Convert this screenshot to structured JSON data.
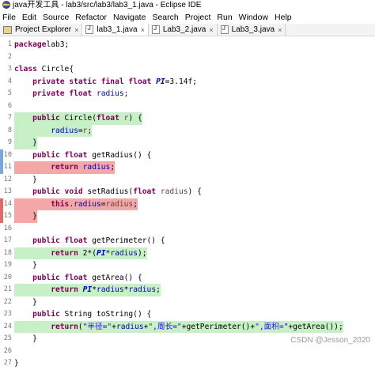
{
  "window": {
    "title": "java开发工具 - lab3/src/lab3/lab3_1.java - Eclipse IDE"
  },
  "menu": [
    "File",
    "Edit",
    "Source",
    "Refactor",
    "Navigate",
    "Search",
    "Project",
    "Run",
    "Window",
    "Help"
  ],
  "tabs": [
    {
      "label": "Project Explorer",
      "icon": "project-explorer-icon",
      "active": false
    },
    {
      "label": "lab3_1.java",
      "icon": "java-file-icon",
      "active": true
    },
    {
      "label": "Lab3_2.java",
      "icon": "java-file-icon",
      "active": false
    },
    {
      "label": "Lab3_3.java",
      "icon": "java-file-icon",
      "active": false
    }
  ],
  "code_lines": [
    {
      "n": "1",
      "hl": "",
      "tokens": [
        [
          "kw",
          "package"
        ],
        [
          "",
          "lab3;"
        ]
      ]
    },
    {
      "n": "2",
      "hl": "",
      "tokens": []
    },
    {
      "n": "3",
      "hl": "",
      "tokens": [
        [
          "kw",
          "class"
        ],
        [
          "",
          " Circle{"
        ]
      ]
    },
    {
      "n": "4",
      "hl": "",
      "tokens": [
        [
          "",
          "    "
        ],
        [
          "kw",
          "private static final float"
        ],
        [
          "",
          " "
        ],
        [
          "cst",
          "PI"
        ],
        [
          "",
          "=3.14f;"
        ]
      ]
    },
    {
      "n": "5",
      "hl": "",
      "tokens": [
        [
          "",
          "    "
        ],
        [
          "kw",
          "private float"
        ],
        [
          "",
          " "
        ],
        [
          "fld",
          "radius"
        ],
        [
          "",
          ";"
        ]
      ]
    },
    {
      "n": "6",
      "hl": "",
      "tokens": []
    },
    {
      "n": "7",
      "hl": "green",
      "tokens": [
        [
          "",
          "    "
        ],
        [
          "kw",
          "public"
        ],
        [
          "",
          " Circle("
        ],
        [
          "kw",
          "float"
        ],
        [
          "",
          " "
        ],
        [
          "par",
          "r"
        ],
        [
          "",
          ") {"
        ]
      ]
    },
    {
      "n": "8",
      "hl": "green",
      "tokens": [
        [
          "",
          "        "
        ],
        [
          "fld",
          "radius"
        ],
        [
          "",
          "="
        ],
        [
          "par",
          "r"
        ],
        [
          "",
          ";"
        ]
      ]
    },
    {
      "n": "9",
      "hl": "green",
      "tokens": [
        [
          "",
          "    }"
        ]
      ]
    },
    {
      "n": "10",
      "hl": "",
      "marker": "blue",
      "tokens": [
        [
          "",
          "    "
        ],
        [
          "kw",
          "public"
        ],
        [
          "",
          " "
        ],
        [
          "kw",
          "float"
        ],
        [
          "",
          " getRadius() {"
        ]
      ]
    },
    {
      "n": "11",
      "hl": "red",
      "marker": "blue",
      "tokens": [
        [
          "",
          "        "
        ],
        [
          "kw",
          "return"
        ],
        [
          "",
          " "
        ],
        [
          "fld",
          "radius"
        ],
        [
          "",
          ";"
        ]
      ]
    },
    {
      "n": "12",
      "hl": "",
      "tokens": [
        [
          "",
          "    }"
        ]
      ]
    },
    {
      "n": "13",
      "hl": "",
      "tokens": [
        [
          "",
          "    "
        ],
        [
          "kw",
          "public void"
        ],
        [
          "",
          " setRadius("
        ],
        [
          "kw",
          "float"
        ],
        [
          "",
          " "
        ],
        [
          "par",
          "radius"
        ],
        [
          "",
          ") {"
        ]
      ]
    },
    {
      "n": "14",
      "hl": "red",
      "marker": "red",
      "tokens": [
        [
          "",
          "        "
        ],
        [
          "kw",
          "this"
        ],
        [
          "",
          "."
        ],
        [
          "fld",
          "radius"
        ],
        [
          "",
          "="
        ],
        [
          "par",
          "radius"
        ],
        [
          "",
          ";"
        ]
      ]
    },
    {
      "n": "15",
      "hl": "red",
      "marker": "red",
      "tokens": [
        [
          "",
          "    }"
        ]
      ]
    },
    {
      "n": "16",
      "hl": "",
      "tokens": []
    },
    {
      "n": "17",
      "hl": "",
      "tokens": [
        [
          "",
          "    "
        ],
        [
          "kw",
          "public float"
        ],
        [
          "",
          " getPerimeter() {"
        ]
      ]
    },
    {
      "n": "18",
      "hl": "green",
      "tokens": [
        [
          "",
          "        "
        ],
        [
          "kw",
          "return"
        ],
        [
          "",
          " 2*("
        ],
        [
          "cst",
          "PI"
        ],
        [
          "",
          "*"
        ],
        [
          "fld",
          "radius"
        ],
        [
          "",
          ");"
        ]
      ]
    },
    {
      "n": "19",
      "hl": "",
      "tokens": [
        [
          "",
          "    }"
        ]
      ]
    },
    {
      "n": "20",
      "hl": "",
      "tokens": [
        [
          "",
          "    "
        ],
        [
          "kw",
          "public float"
        ],
        [
          "",
          " getArea() {"
        ]
      ]
    },
    {
      "n": "21",
      "hl": "green",
      "tokens": [
        [
          "",
          "        "
        ],
        [
          "kw",
          "return"
        ],
        [
          "",
          " "
        ],
        [
          "cst",
          "PI"
        ],
        [
          "",
          "*"
        ],
        [
          "fld",
          "radius"
        ],
        [
          "",
          "*"
        ],
        [
          "fld",
          "radius"
        ],
        [
          "",
          ";"
        ]
      ]
    },
    {
      "n": "22",
      "hl": "",
      "tokens": [
        [
          "",
          "    }"
        ]
      ]
    },
    {
      "n": "23",
      "hl": "",
      "tokens": [
        [
          "",
          "    "
        ],
        [
          "kw",
          "public"
        ],
        [
          "",
          " String toString() {"
        ]
      ]
    },
    {
      "n": "24",
      "hl": "green",
      "tokens": [
        [
          "",
          "        "
        ],
        [
          "kw",
          "return"
        ],
        [
          "",
          "("
        ],
        [
          "str",
          "\"半径=\""
        ],
        [
          "",
          "+"
        ],
        [
          "fld",
          "radius"
        ],
        [
          "",
          "+"
        ],
        [
          "str",
          "\",周长=\""
        ],
        [
          "",
          "+getPerimeter()+"
        ],
        [
          "str",
          "\",面积=\""
        ],
        [
          "",
          "+getArea());"
        ]
      ]
    },
    {
      "n": "25",
      "hl": "",
      "tokens": [
        [
          "",
          "    }"
        ]
      ]
    },
    {
      "n": "26",
      "hl": "",
      "tokens": []
    },
    {
      "n": "27",
      "hl": "",
      "tokens": [
        [
          "",
          "}"
        ]
      ]
    }
  ],
  "watermark": "CSDN @Jesson_2020",
  "colors": {
    "keyword": "#7f0055",
    "field": "#0000c0",
    "string": "#2a00ff",
    "covered": "#c7f0c7",
    "not_covered": "#f4a7a7"
  }
}
